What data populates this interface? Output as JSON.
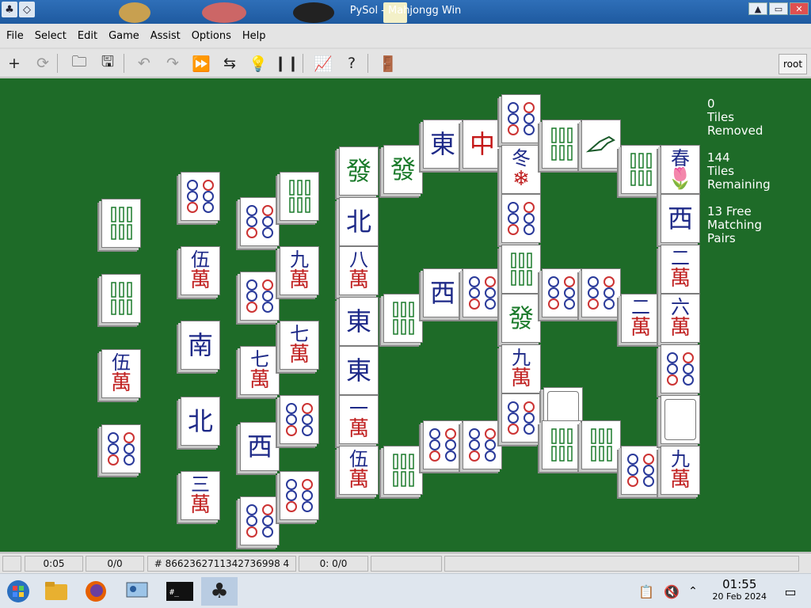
{
  "window": {
    "title": "PySol - Mahjongg Win",
    "sys_icons": [
      "♣",
      "◇"
    ],
    "controls": [
      "▲",
      "▭",
      "✕"
    ]
  },
  "menu": [
    "File",
    "Select",
    "Edit",
    "Game",
    "Assist",
    "Options",
    "Help"
  ],
  "toolbar": {
    "items": [
      {
        "name": "new-game-icon",
        "glyph": "+",
        "dim": false
      },
      {
        "name": "restart-icon",
        "glyph": "⟳",
        "dim": true
      },
      {
        "name": "open-folder-icon",
        "glyph": "🗀",
        "dim": false
      },
      {
        "name": "save-icon",
        "glyph": "🖫",
        "dim": false
      },
      {
        "name": "undo-icon",
        "glyph": "↶",
        "dim": true
      },
      {
        "name": "redo-icon",
        "glyph": "↷",
        "dim": true
      },
      {
        "name": "autodrop-icon",
        "glyph": "⏩",
        "dim": true
      },
      {
        "name": "shuffle-icon",
        "glyph": "⇆",
        "dim": false
      },
      {
        "name": "hint-icon",
        "glyph": "💡",
        "dim": false
      },
      {
        "name": "pause-icon",
        "glyph": "❙❙",
        "dim": false
      },
      {
        "name": "statistics-icon",
        "glyph": "📈",
        "dim": false
      },
      {
        "name": "rules-icon",
        "glyph": "?",
        "dim": false
      },
      {
        "name": "quit-icon",
        "glyph": "🚪",
        "dim": false
      }
    ],
    "player": "root"
  },
  "stats": {
    "removed_count": "0",
    "removed_label1": "Tiles",
    "removed_label2": "Removed",
    "remaining_count": "144",
    "remaining_label1": "Tiles",
    "remaining_label2": "Remaining",
    "pairs_line1": "13 Free",
    "pairs_line2": "Matching",
    "pairs_line3": "Pairs"
  },
  "tiles": {
    "c1_1": {
      "kind": "bamboo",
      "label": "bamboo-tile"
    },
    "c1_2": {
      "kind": "bamboo",
      "label": "bamboo-tile"
    },
    "c1_3": {
      "top": "伍",
      "bot": "萬"
    },
    "c1_4": {
      "kind": "circle",
      "label": "circle-tile"
    },
    "c2_1": {
      "kind": "circle",
      "label": "circle-tile"
    },
    "c2_2": {
      "top": "伍",
      "bot": "萬"
    },
    "c2_3": {
      "char": "南",
      "color": "blue"
    },
    "c2_4": {
      "char": "北",
      "color": "blue"
    },
    "c2_5": {
      "top": "三",
      "bot": "萬"
    },
    "c3_1": {
      "kind": "circle",
      "label": "circle-tile"
    },
    "c3_2": {
      "kind": "circle",
      "label": "circle-tile"
    },
    "c3_3": {
      "top": "七",
      "bot": "萬"
    },
    "c3_4": {
      "char": "西",
      "color": "blue"
    },
    "c3_5": {
      "kind": "circle",
      "label": "circle-tile"
    },
    "c4_1": {
      "kind": "bamboo",
      "label": "bamboo-tile"
    },
    "c4_2": {
      "top": "九",
      "bot": "萬"
    },
    "c4_3": {
      "top": "七",
      "bot": "萬"
    },
    "c4_4": {
      "kind": "circle",
      "label": "circle-tile"
    },
    "c4_5": {
      "kind": "circle",
      "label": "circle-tile"
    },
    "c5_1": {
      "char": "發",
      "color": "green"
    },
    "c5_2": {
      "char": "北",
      "color": "blue"
    },
    "c5_3": {
      "top": "八",
      "bot": "萬"
    },
    "c5_4": {
      "char": "東",
      "color": "blue"
    },
    "c5_5": {
      "char": "東",
      "color": "blue"
    },
    "c5_6": {
      "top": "一",
      "bot": "萬"
    },
    "c5_7": {
      "top": "伍",
      "bot": "萬"
    },
    "c6_1": {
      "char": "發",
      "color": "green"
    },
    "c6_2": {
      "kind": "bamboo",
      "label": "bamboo-tile"
    },
    "c6_3": {
      "kind": "bamboo",
      "label": "bamboo-tile"
    },
    "c7_1": {
      "char": "東",
      "color": "blue"
    },
    "c7_2": {
      "char": "西",
      "color": "blue"
    },
    "c7_3": {
      "kind": "circle",
      "label": "circle-tile"
    },
    "c8_1": {
      "char": "中",
      "color": "red"
    },
    "c8_2": {
      "kind": "circle",
      "label": "circle-tile"
    },
    "c8_3": {
      "kind": "circle",
      "label": "circle-tile"
    },
    "c9_1": {
      "kind": "circle",
      "label": "circle-tile"
    },
    "c9_2": {
      "top": "冬",
      "bot": "❄"
    },
    "c9_3": {
      "kind": "circle",
      "label": "circle-tile"
    },
    "c9_4": {
      "kind": "bamboo",
      "label": "bamboo-tile"
    },
    "c9_5": {
      "char": "發",
      "color": "green"
    },
    "c9_6": {
      "top": "九",
      "bot": "萬"
    },
    "c9_7": {
      "kind": "circle",
      "label": "circle-tile"
    },
    "c10_1": {
      "kind": "bamboo",
      "label": "bamboo-tile"
    },
    "c10_2": {
      "kind": "circle",
      "label": "circle-tile"
    },
    "c10_3": {
      "kind": "blank",
      "label": "blank-tile"
    },
    "c10_4": {
      "kind": "bamboo",
      "label": "bamboo-tile"
    },
    "c11_1": {
      "kind": "bird",
      "label": "bird-tile"
    },
    "c11_2": {
      "kind": "circle",
      "label": "circle-tile"
    },
    "c11_3": {
      "kind": "bamboo",
      "label": "bamboo-tile"
    },
    "c12_1": {
      "kind": "bamboo",
      "label": "bamboo-tile"
    },
    "c12_2": {
      "top": "二",
      "bot": "萬"
    },
    "c12_3": {
      "kind": "circle",
      "label": "circle-tile"
    },
    "c13_1": {
      "top": "春",
      "bot": "🌷"
    },
    "c13_2": {
      "char": "西",
      "color": "blue"
    },
    "c13_3": {
      "top": "二",
      "bot": "萬"
    },
    "c13_4": {
      "top": "六",
      "bot": "萬"
    },
    "c13_5": {
      "kind": "circle",
      "label": "circle-tile"
    },
    "c13_6": {
      "kind": "blank",
      "label": "blank-tile"
    },
    "c13_7": {
      "top": "九",
      "bot": "萬"
    }
  },
  "status": {
    "time": "0:05",
    "moves": "0/0",
    "game_number": "# 8662362711342736998 4",
    "score": "0: 0/0"
  },
  "taskbar": {
    "time": "01:55",
    "date": "20 Feb 2024"
  }
}
